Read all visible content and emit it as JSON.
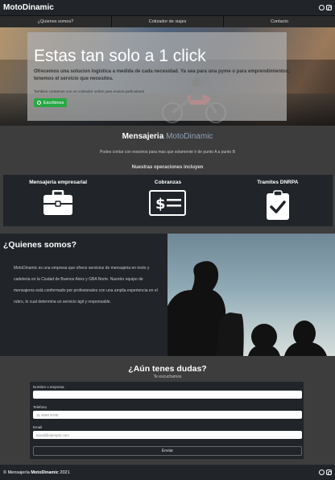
{
  "navbar": {
    "brand": "MotoDinamic",
    "icons": [
      "whatsapp-icon",
      "instagram-icon"
    ]
  },
  "menu": [
    {
      "label": "¿Quienes somos?"
    },
    {
      "label": "Cotizador de viajes"
    },
    {
      "label": "Contacto"
    }
  ],
  "hero": {
    "title": "Estas tan solo a 1 click",
    "lead": "Ofrecemos una solucion logística a medida de cada necesidad. Ya sea para una pyme o para emprendimientos, tenemos el servicio que necesites.",
    "small": "Tambien contamos con un cotizador online para envios particulares",
    "button_label": "Escribinos"
  },
  "mensajeria": {
    "title_main": "Mensajeria",
    "title_accent": "MotoDinamic",
    "subtitle": "Podes contar con nosotros para mas que solamente ir de punto A a punto B",
    "ops_title": "Nuestras operaciones incluyen",
    "operations": [
      {
        "label": "Mensajeria empresarial",
        "icon": "briefcase-icon"
      },
      {
        "label": "Cobranzas",
        "icon": "money-bill-icon"
      },
      {
        "label": "Tramites DNRPA",
        "icon": "clipboard-check-icon"
      }
    ]
  },
  "quienes": {
    "title": "¿Quienes somos?",
    "text": "MotoDinamic es una empresa que ofrece servicios de mensajeria en moto y cadeteria en la Ciudad de Buenos Aires y GBA Norte. Nuestro equipo de mensajeros está conformado por profesionales con una amplia experiencia en el rubro, lo cual determina un servicio ágil y responsable."
  },
  "contacto": {
    "title": "¿Aún tenes dudas?",
    "subtitle": "Te escuchamos",
    "fields": [
      {
        "label": "Nombre o empresa",
        "placeholder": "-"
      },
      {
        "label": "Telefono",
        "placeholder": "11 4569 9780"
      },
      {
        "label": "Email",
        "placeholder": "email@ejemplo.com"
      }
    ],
    "submit_label": "Enviar"
  },
  "footer": {
    "prefix": "© Mensajería",
    "brand": "MotoDinamic",
    "year": "2021"
  },
  "colors": {
    "dark": "#212529",
    "body": "#3d3d3d",
    "accent": "#8fa0b8",
    "whatsapp": "#28a745"
  }
}
